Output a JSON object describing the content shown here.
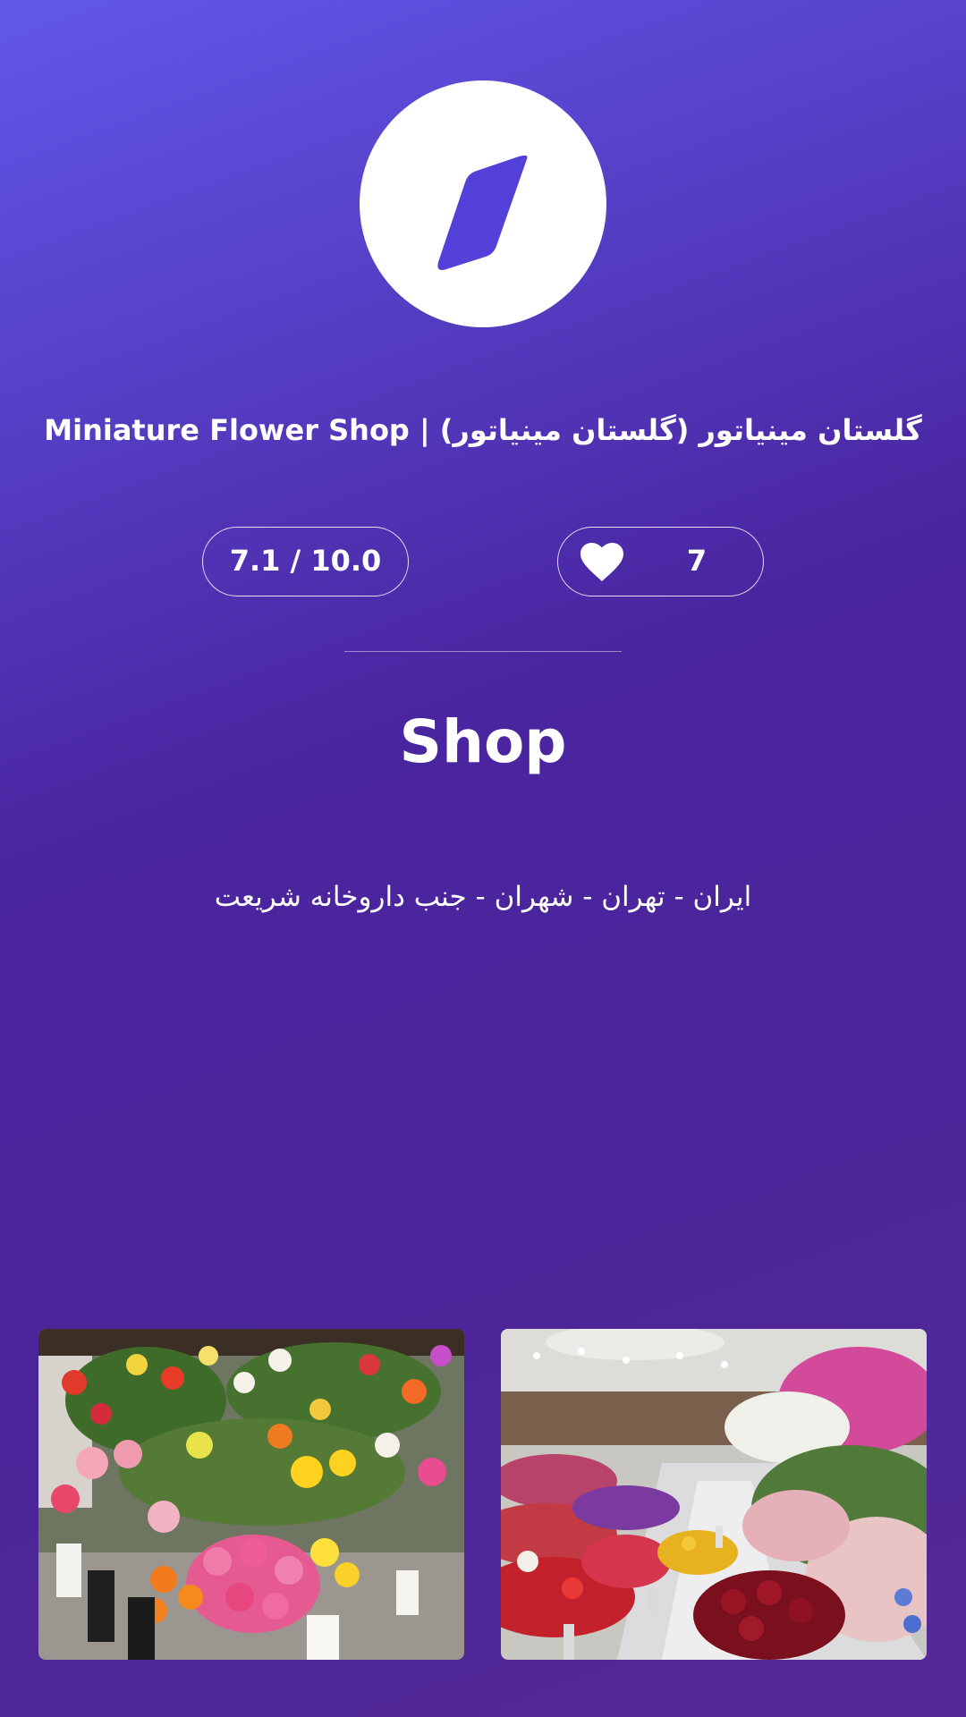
{
  "header": {
    "logo_icon": "compass-diamond-icon",
    "title": "Miniature Flower Shop | گلستان مینیاتور (گلستان مینیاتور)"
  },
  "stats": {
    "score": "7.1 / 10.0",
    "likes_icon": "heart-icon",
    "likes": "7"
  },
  "place": {
    "category": "Shop",
    "address": "ایران - تهران - شهران - جنب  داروخانه شریعت"
  },
  "gallery": {
    "photos": [
      {
        "subject": "flower-bouquets-photo"
      },
      {
        "subject": "flower-shop-interior-photo"
      }
    ]
  },
  "colors": {
    "accent": "#5240d8",
    "gradient_top": "#6158ea",
    "gradient_bottom": "#552a96"
  }
}
